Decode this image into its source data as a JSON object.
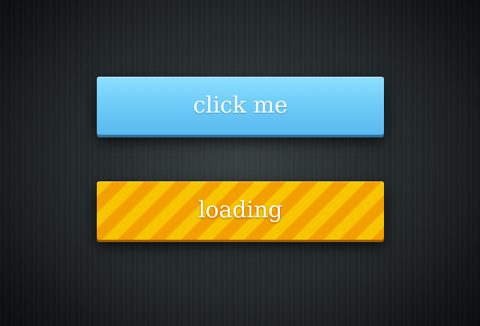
{
  "buttons": {
    "primary_label": "click me",
    "loading_label": "loading"
  },
  "colors": {
    "primary_button": "#6fcdf8",
    "loading_stripe_light": "#f7c400",
    "loading_stripe_dark": "#f29f00",
    "background": "#202527"
  }
}
